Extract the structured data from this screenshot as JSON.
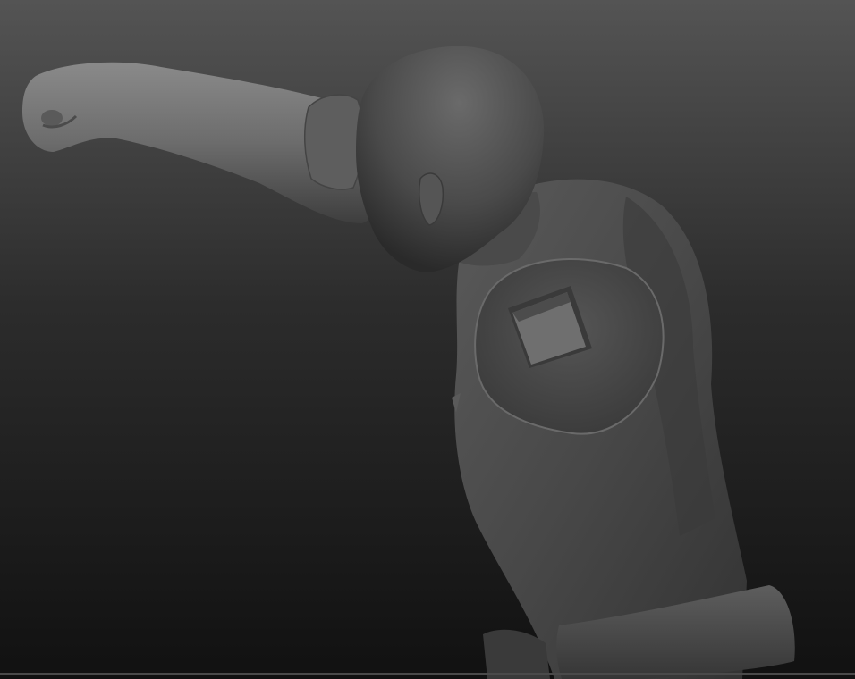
{
  "scene": {
    "background_top": "#505050",
    "background_bottom": "#111111",
    "material_light": "#7a7a7a",
    "material_mid": "#4f4f4f",
    "material_dark": "#2b2b2b",
    "window_fill": "#6e6e6e",
    "edge_line": "#4a4a4a"
  }
}
